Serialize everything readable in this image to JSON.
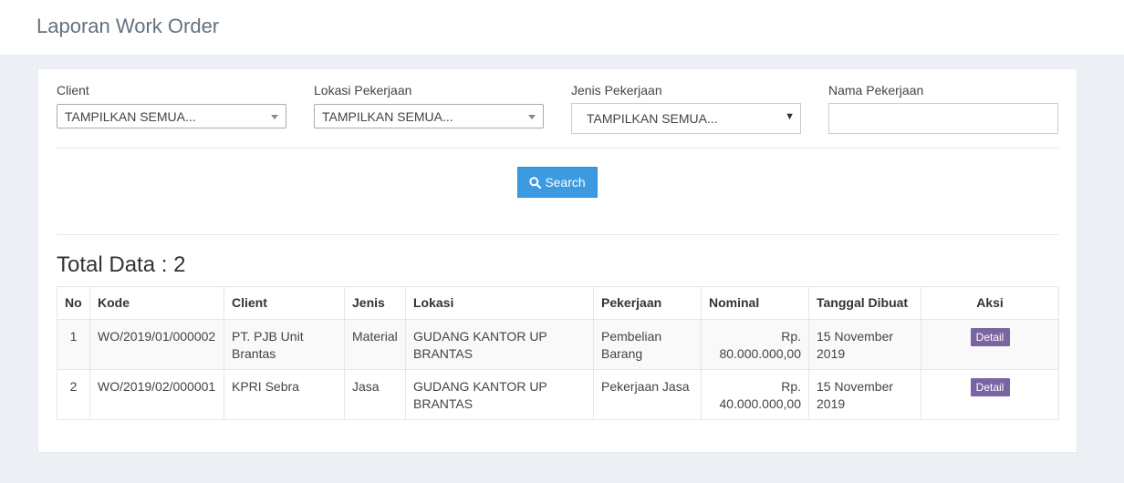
{
  "header": {
    "title": "Laporan Work Order"
  },
  "filters": {
    "client": {
      "label": "Client",
      "value": "TAMPILKAN SEMUA..."
    },
    "lokasi": {
      "label": "Lokasi Pekerjaan",
      "value": "TAMPILKAN SEMUA..."
    },
    "jenis": {
      "label": "Jenis Pekerjaan",
      "value": "TAMPILKAN SEMUA..."
    },
    "nama": {
      "label": "Nama Pekerjaan",
      "value": ""
    }
  },
  "search": {
    "label": "Search",
    "icon": "search-icon"
  },
  "total": {
    "text": "Total Data : 2"
  },
  "table": {
    "columns": [
      "No",
      "Kode",
      "Client",
      "Jenis",
      "Lokasi",
      "Pekerjaan",
      "Nominal",
      "Tanggal Dibuat",
      "Aksi"
    ],
    "rows": [
      {
        "no": "1",
        "kode": "WO/2019/01/000002",
        "client": "PT. PJB Unit Brantas",
        "jenis": "Material",
        "lokasi": "GUDANG KANTOR UP BRANTAS",
        "pekerjaan": "Pembelian Barang",
        "nominal": "Rp. 80.000.000,00",
        "tanggal": "15 November 2019",
        "aksi": "Detail"
      },
      {
        "no": "2",
        "kode": "WO/2019/02/000001",
        "client": "KPRI Sebra",
        "jenis": "Jasa",
        "lokasi": "GUDANG KANTOR UP BRANTAS",
        "pekerjaan": "Pekerjaan Jasa",
        "nominal": "Rp. 40.000.000,00",
        "tanggal": "15 November 2019",
        "aksi": "Detail"
      }
    ]
  },
  "colors": {
    "primary": "#3c9ae0",
    "detail": "#7b64a2",
    "background": "#ecf0f5"
  }
}
